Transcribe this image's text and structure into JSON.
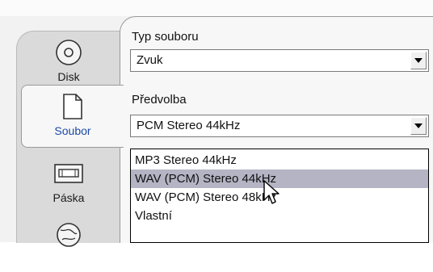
{
  "sidebar": {
    "items": [
      {
        "label": "Disk",
        "icon": "disc-icon",
        "active": false
      },
      {
        "label": "Soubor",
        "icon": "file-icon",
        "active": true
      },
      {
        "label": "Páska",
        "icon": "tape-icon",
        "active": false
      },
      {
        "label": "",
        "icon": "web-icon",
        "active": false
      }
    ]
  },
  "form": {
    "file_type_label": "Typ souboru",
    "file_type_value": "Zvuk",
    "preset_label": "Předvolba",
    "preset_value": "PCM Stereo 44kHz"
  },
  "dropdown": {
    "options": [
      "MP3 Stereo 44kHz",
      "WAV (PCM) Stereo 44kHz",
      "WAV (PCM) Stereo 48kHz",
      "Vlastní"
    ],
    "highlighted_index": 1
  },
  "colors": {
    "active_label": "#1b4aa5",
    "highlight": "#b4b4c4"
  }
}
